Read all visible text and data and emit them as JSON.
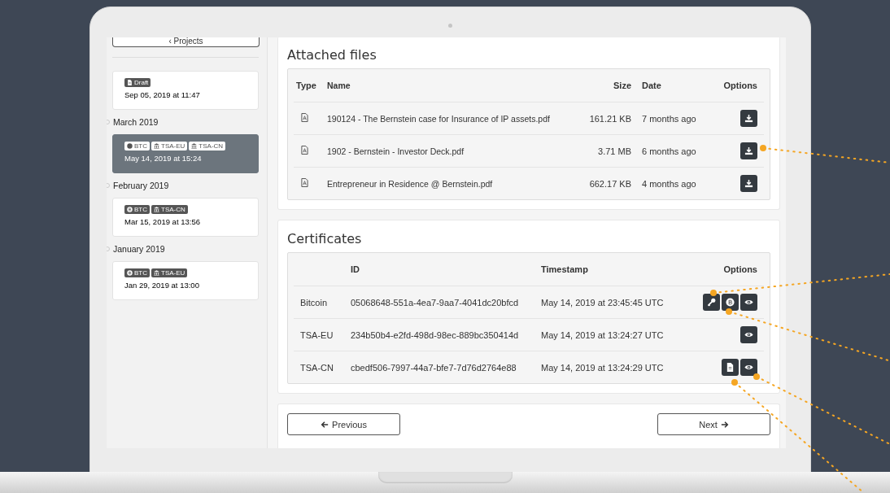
{
  "sidebar": {
    "back_button": "‹ Projects",
    "entries": [
      {
        "kind": "card",
        "selected": false,
        "tags": [
          {
            "kind": "draft",
            "label": "Draft"
          }
        ],
        "date": "Sep 05, 2019 at 11:47"
      },
      {
        "kind": "heading",
        "label": "March 2019"
      },
      {
        "kind": "card",
        "selected": true,
        "tags": [
          {
            "kind": "coin",
            "label": "BTC"
          },
          {
            "kind": "bank",
            "label": "TSA-EU"
          },
          {
            "kind": "bank",
            "label": "TSA-CN"
          }
        ],
        "date": "May 14, 2019 at 15:24"
      },
      {
        "kind": "heading",
        "label": "February 2019"
      },
      {
        "kind": "card",
        "selected": false,
        "tags": [
          {
            "kind": "coin",
            "label": "BTC"
          },
          {
            "kind": "bank",
            "label": "TSA-CN"
          }
        ],
        "date": "Mar 15, 2019 at 13:56"
      },
      {
        "kind": "heading",
        "label": "January 2019"
      },
      {
        "kind": "card",
        "selected": false,
        "tags": [
          {
            "kind": "coin",
            "label": "BTC"
          },
          {
            "kind": "bank",
            "label": "TSA-EU"
          }
        ],
        "date": "Jan 29, 2019 at 13:00"
      }
    ]
  },
  "files": {
    "title": "Attached files",
    "columns": [
      "Type",
      "Name",
      "Size",
      "Date",
      "Options"
    ],
    "rows": [
      {
        "name": "190124 - The Bernstein case for Insurance of IP assets.pdf",
        "size": "161.21 KB",
        "date": "7 months ago"
      },
      {
        "name": "1902 - Bernstein - Investor Deck.pdf",
        "size": "3.71 MB",
        "date": "6 months ago"
      },
      {
        "name": "Entrepreneur in Residence @ Bernstein.pdf",
        "size": "662.17 KB",
        "date": "4 months ago"
      }
    ]
  },
  "certificates": {
    "title": "Certificates",
    "columns": [
      "ID",
      "Timestamp",
      "Options"
    ],
    "rows": [
      {
        "type": "Bitcoin",
        "id": "05068648-551a-4ea7-9aa7-4041dc20bfcd",
        "timestamp": "May 14, 2019 at 23:45:45 UTC",
        "actions": [
          {
            "kind": "key"
          },
          {
            "kind": "coin"
          },
          {
            "kind": "view"
          }
        ]
      },
      {
        "type": "TSA-EU",
        "id": "234b50b4-e2fd-498d-98ec-889bc350414d",
        "timestamp": "May 14, 2019 at 13:24:27 UTC",
        "actions": [
          {
            "kind": "view"
          }
        ]
      },
      {
        "type": "TSA-CN",
        "id": "cbedf506-7997-44a7-bfe7-7d76d2764e88",
        "timestamp": "May 14, 2019 at 13:24:29 UTC",
        "actions": [
          {
            "kind": "document"
          },
          {
            "kind": "view"
          }
        ]
      }
    ]
  },
  "navigation": {
    "previous": "Previous",
    "next": "Next"
  }
}
